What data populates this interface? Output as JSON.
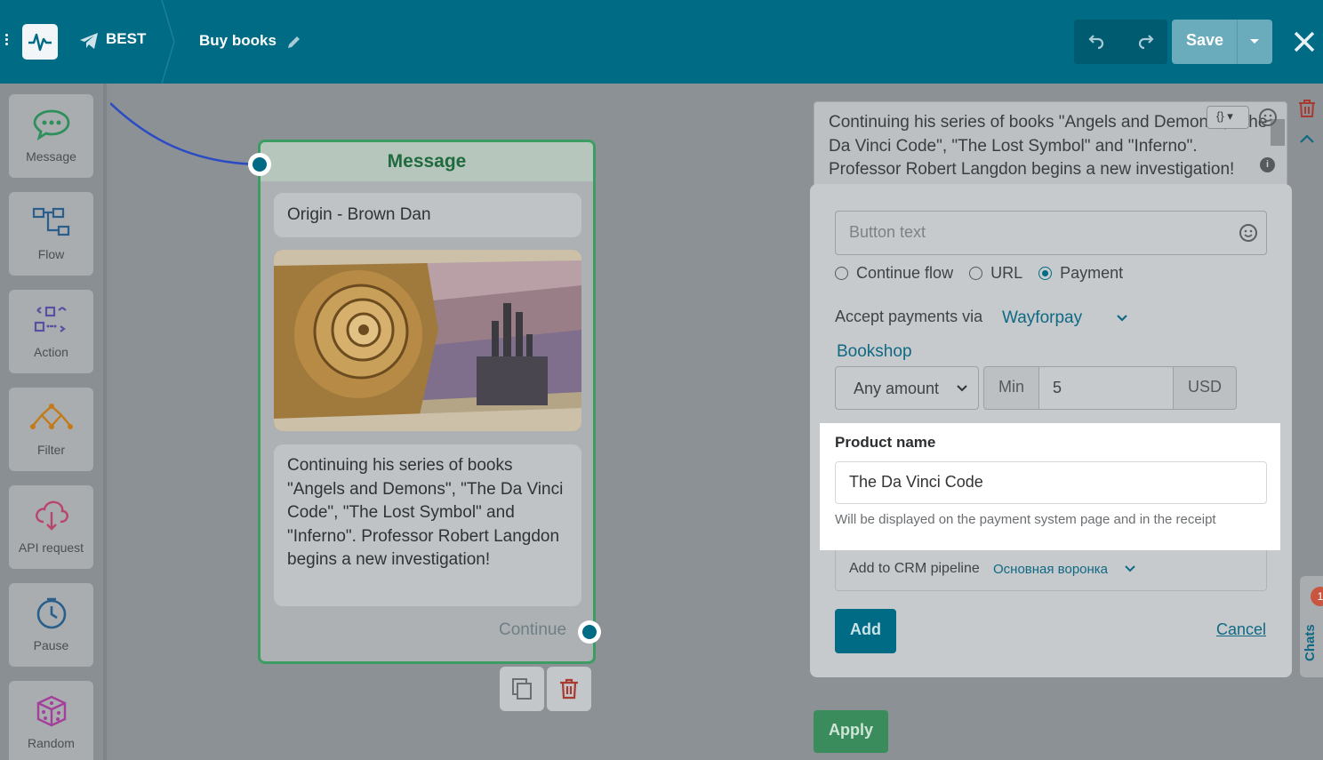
{
  "topbar": {
    "bot_name": "BEST",
    "flow_name": "Buy books",
    "save_label": "Save"
  },
  "toolbar": {
    "items": [
      {
        "label": "Message",
        "icon": "message-bubble-icon",
        "color": "#2f8f5a"
      },
      {
        "label": "Flow",
        "icon": "flow-icon",
        "color": "#2a5f8c"
      },
      {
        "label": "Action",
        "icon": "action-icon",
        "color": "#5a4fa0"
      },
      {
        "label": "Filter",
        "icon": "filter-icon",
        "color": "#c27b18"
      },
      {
        "label": "API request",
        "icon": "api-cloud-icon",
        "color": "#b8456a"
      },
      {
        "label": "Pause",
        "icon": "clock-icon",
        "color": "#2a5f8c"
      },
      {
        "label": "Random",
        "icon": "dice-icon",
        "color": "#a2409a"
      }
    ]
  },
  "node": {
    "header": "Message",
    "title": "Origin - Brown Dan",
    "text": "Continuing his series of books \"Angels and Demons\", \"The Da Vinci Code\", \"The Lost Symbol\" and \"Inferno\". Professor Robert Langdon begins a new investigation!",
    "continue_label": "Continue"
  },
  "panel": {
    "message_text": "Continuing his series of books \"Angels and Demons\", \"The Da Vinci Code\", \"The Lost Symbol\" and \"Inferno\". Professor Robert Langdon begins a new investigation!",
    "button_text_placeholder": "Button text",
    "radio_options": [
      "Continue flow",
      "URL",
      "Payment"
    ],
    "radio_selected": "Payment",
    "accept_label": "Accept payments via",
    "provider": "Wayforpay",
    "shop": "Bookshop",
    "amount_type": "Any amount",
    "min_label": "Min",
    "min_value": "5",
    "currency": "USD",
    "product_name_label": "Product name",
    "product_name_value": "The Da Vinci Code",
    "product_name_hint": "Will be displayed on the payment system page and in the receipt",
    "crm_label": "Add to CRM pipeline",
    "crm_value": "Основная воронка",
    "add_label": "Add",
    "cancel_label": "Cancel",
    "apply_label": "Apply",
    "chats_label": "Chats",
    "chats_badge": "1"
  },
  "colors": {
    "brand": "#006b84",
    "accent_green": "#3b9d62",
    "link": "#0f6984"
  }
}
